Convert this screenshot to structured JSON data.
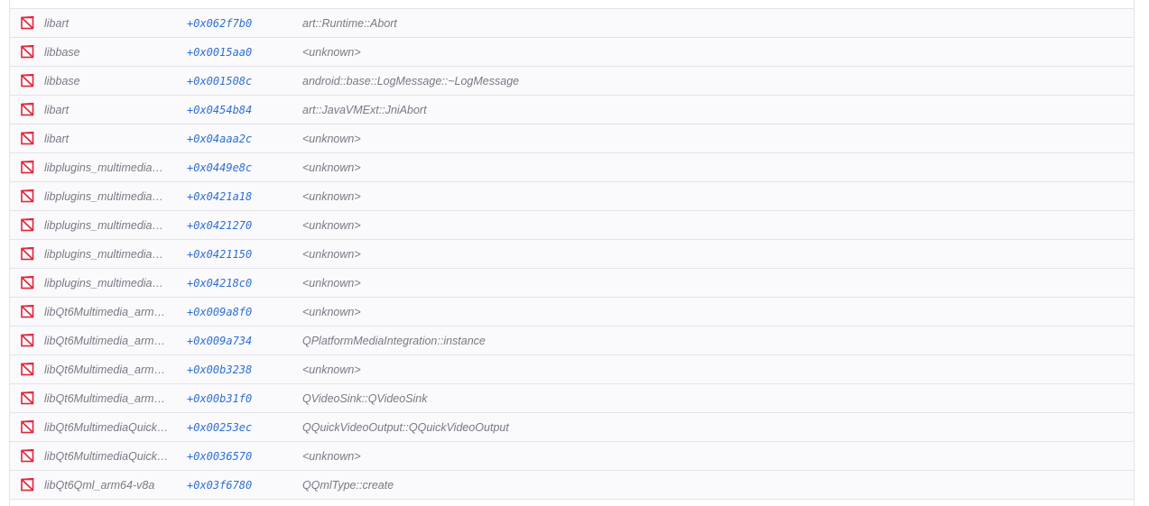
{
  "frames": [
    {
      "lib": "libart",
      "addr": "+0x062f7b0",
      "func": "art::Runtime::Abort"
    },
    {
      "lib": "libbase",
      "addr": "+0x0015aa0",
      "func": "<unknown>"
    },
    {
      "lib": "libbase",
      "addr": "+0x001508c",
      "func": "android::base::LogMessage::~LogMessage"
    },
    {
      "lib": "libart",
      "addr": "+0x0454b84",
      "func": "art::JavaVMExt::JniAbort"
    },
    {
      "lib": "libart",
      "addr": "+0x04aaa2c",
      "func": "<unknown>"
    },
    {
      "lib": "libplugins_multimedia…",
      "addr": "+0x0449e8c",
      "func": "<unknown>"
    },
    {
      "lib": "libplugins_multimedia…",
      "addr": "+0x0421a18",
      "func": "<unknown>"
    },
    {
      "lib": "libplugins_multimedia…",
      "addr": "+0x0421270",
      "func": "<unknown>"
    },
    {
      "lib": "libplugins_multimedia…",
      "addr": "+0x0421150",
      "func": "<unknown>"
    },
    {
      "lib": "libplugins_multimedia…",
      "addr": "+0x04218c0",
      "func": "<unknown>"
    },
    {
      "lib": "libQt6Multimedia_arm…",
      "addr": "+0x009a8f0",
      "func": "<unknown>"
    },
    {
      "lib": "libQt6Multimedia_arm…",
      "addr": "+0x009a734",
      "func": "QPlatformMediaIntegration::instance"
    },
    {
      "lib": "libQt6Multimedia_arm…",
      "addr": "+0x00b3238",
      "func": "<unknown>"
    },
    {
      "lib": "libQt6Multimedia_arm…",
      "addr": "+0x00b31f0",
      "func": "QVideoSink::QVideoSink"
    },
    {
      "lib": "libQt6MultimediaQuick…",
      "addr": "+0x00253ec",
      "func": "QQuickVideoOutput::QQuickVideoOutput"
    },
    {
      "lib": "libQt6MultimediaQuick…",
      "addr": "+0x0036570",
      "func": "<unknown>"
    },
    {
      "lib": "libQt6Qml_arm64-v8a",
      "addr": "+0x03f6780",
      "func": "QQmlType::create"
    }
  ],
  "colors": {
    "icon": "#e0263b",
    "address": "#2f6fd2",
    "text": "#7b7785",
    "border": "#e3e3ea"
  },
  "icon_name": "non-app-frame-icon"
}
